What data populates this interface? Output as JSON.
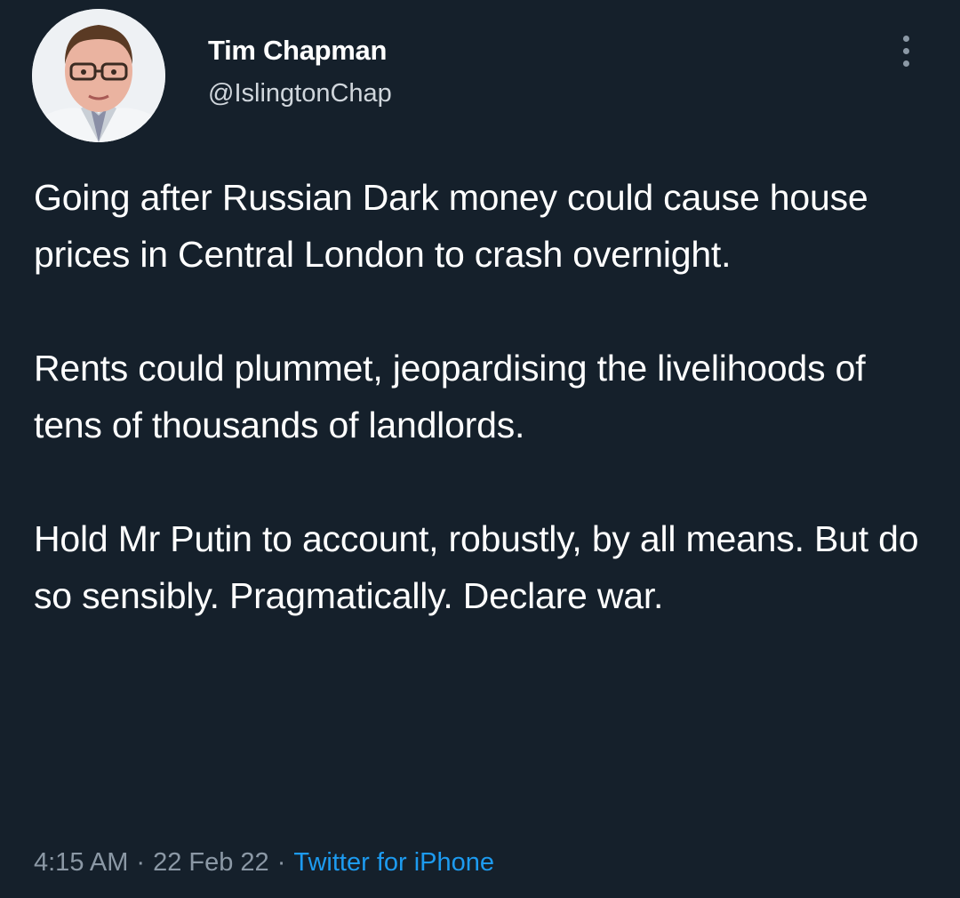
{
  "tweet": {
    "author": {
      "display_name": "Tim Chapman",
      "handle": "@IslingtonChap",
      "avatar_icon": "profile-photo-avatar"
    },
    "more_icon": "more-options-icon",
    "paragraphs": [
      "Going after Russian Dark money could cause house prices in Central London to crash overnight.",
      "Rents could plummet, jeopardising the livelihoods of tens of thousands of landlords.",
      "Hold Mr Putin to account, robustly, by all means. But do so sensibly. Pragmatically. Declare war."
    ],
    "meta": {
      "time": "4:15 AM",
      "separator": "·",
      "date": "22 Feb 22",
      "source": "Twitter for iPhone"
    }
  },
  "colors": {
    "background": "#15202b",
    "text": "#ffffff",
    "secondary": "#8b98a5",
    "link": "#1d9bf0"
  }
}
